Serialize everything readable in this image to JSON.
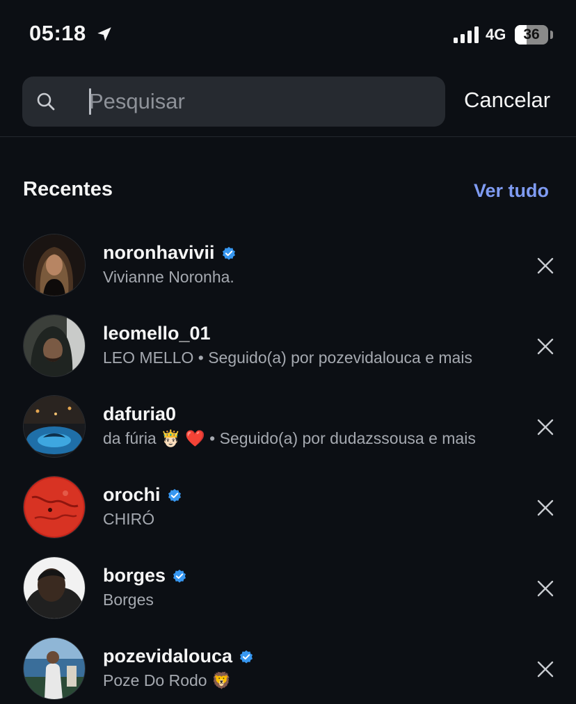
{
  "status_bar": {
    "time": "05:18",
    "network": "4G",
    "battery_percent": 36,
    "battery_label": "36"
  },
  "search": {
    "value": "",
    "placeholder": "Pesquisar",
    "cancel_label": "Cancelar"
  },
  "recent": {
    "title": "Recentes",
    "see_all_label": "Ver tudo",
    "items": [
      {
        "username": "noronhavivii",
        "subtitle": "Vivianne Noronha.",
        "verified": true
      },
      {
        "username": "leomello_01",
        "subtitle": "LEO MELLO • Seguido(a) por pozevidalouca e mais",
        "verified": false
      },
      {
        "username": "dafuria0",
        "subtitle": "da fúria 🤴🏻 ❤️  • Seguido(a) por dudazssousa e mais",
        "verified": false
      },
      {
        "username": "orochi",
        "subtitle": "CHIRÓ",
        "verified": true
      },
      {
        "username": "borges",
        "subtitle": "Borges",
        "verified": true
      },
      {
        "username": "pozevidalouca",
        "subtitle": "Poze Do Rodo 🦁",
        "verified": true
      }
    ]
  },
  "colors": {
    "background": "#0c0f14",
    "search_bg": "#262a30",
    "accent_link": "#7f9bf2",
    "verified_badge": "#3797f0",
    "secondary_text": "#a5a9b0"
  }
}
